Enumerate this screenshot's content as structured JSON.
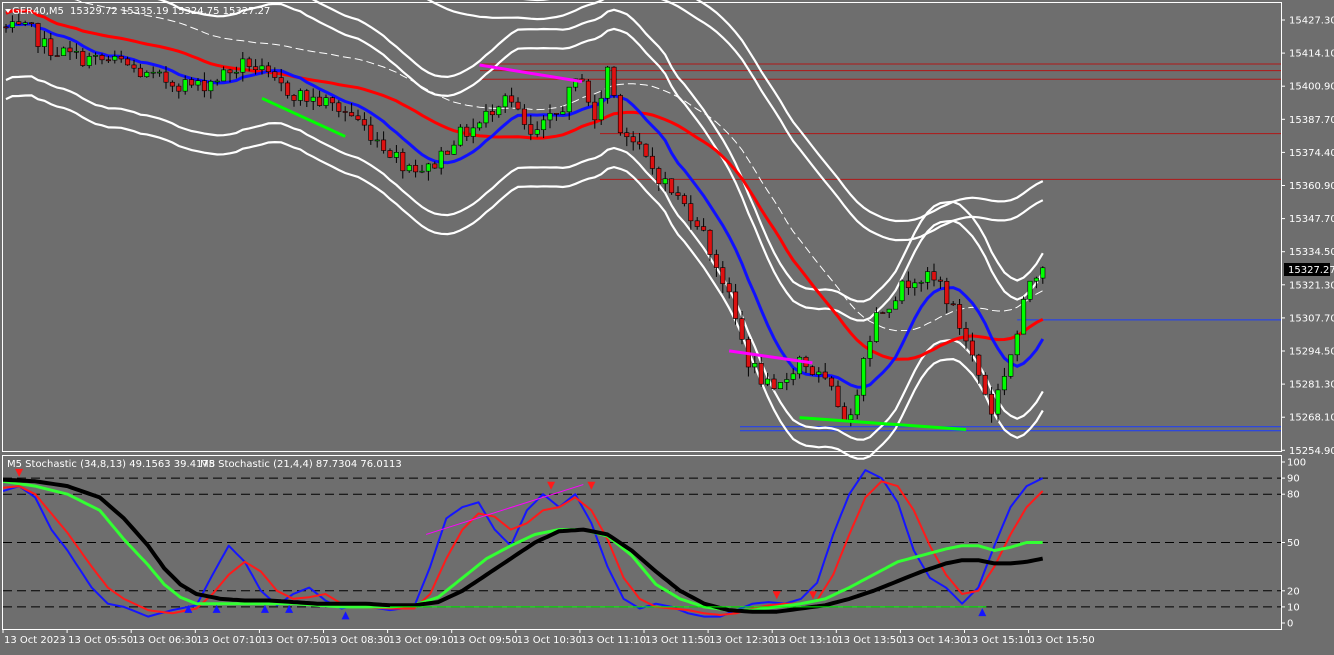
{
  "header": {
    "symbol": "GER40,M5",
    "ohlc": "15329.72 15335.19 15324.75 15327.27"
  },
  "indicator_header": {
    "stoch1": "M5 Stochastic (34,8,13) 49.1563 39.4178",
    "stoch2": "M5 Stochastic (21,4,4) 87.7304 76.0113"
  },
  "current_price_label": "15327.27",
  "colors": {
    "background": "#6e6e6e",
    "bull": "#00ff00",
    "bear": "#dd1111",
    "ma_red": "#ff0000",
    "ma_blue": "#1010ff",
    "envelope": "#ffffff",
    "divergence_magenta": "#ff00ff",
    "divergence_green": "#00ff00",
    "stoch_blue": "#1515ff",
    "stoch_red": "#ff1a1a",
    "stoch_green": "#33ff33",
    "stoch_black": "#000000",
    "level_line": "#b01818",
    "support_line": "#1a3cff"
  },
  "chart_data": [
    {
      "type": "candlestick",
      "panel": "price",
      "ylim": [
        15248.0,
        15436.0
      ],
      "y_ticks": [
        "15427.30",
        "15414.10",
        "15400.90",
        "15387.70",
        "15374.40",
        "15360.90",
        "15347.70",
        "15334.50",
        "15321.30",
        "15307.70",
        "15294.50",
        "15281.30",
        "15268.10",
        "15254.90"
      ],
      "x_ticks": [
        "13 Oct 2023",
        "13 Oct 05:50",
        "13 Oct 06:30",
        "13 Oct 07:10",
        "13 Oct 07:50",
        "13 Oct 08:30",
        "13 Oct 09:10",
        "13 Oct 09:50",
        "13 Oct 10:30",
        "13 Oct 11:10",
        "13 Oct 11:50",
        "13 Oct 12:30",
        "13 Oct 13:10",
        "13 Oct 13:50",
        "13 Oct 14:30",
        "13 Oct 15:10",
        "13 Oct 15:50"
      ],
      "candle_count": 163,
      "close_anchors": [
        [
          0,
          15425
        ],
        [
          4,
          15424
        ],
        [
          6,
          15418
        ],
        [
          10,
          15414
        ],
        [
          14,
          15412
        ],
        [
          18,
          15411
        ],
        [
          22,
          15405
        ],
        [
          26,
          15403
        ],
        [
          30,
          15401
        ],
        [
          34,
          15406
        ],
        [
          38,
          15411
        ],
        [
          42,
          15402
        ],
        [
          46,
          15397
        ],
        [
          50,
          15394
        ],
        [
          54,
          15389
        ],
        [
          58,
          15379
        ],
        [
          62,
          15369
        ],
        [
          66,
          15366
        ],
        [
          70,
          15379
        ],
        [
          74,
          15385
        ],
        [
          78,
          15399
        ],
        [
          82,
          15379
        ],
        [
          86,
          15389
        ],
        [
          90,
          15406
        ],
        [
          92,
          15385
        ],
        [
          94,
          15409
        ],
        [
          96,
          15385
        ],
        [
          100,
          15370
        ],
        [
          104,
          15357
        ],
        [
          108,
          15345
        ],
        [
          112,
          15320
        ],
        [
          116,
          15286
        ],
        [
          120,
          15271
        ],
        [
          124,
          15287
        ],
        [
          128,
          15276
        ],
        [
          132,
          15260
        ],
        [
          134,
          15289
        ],
        [
          136,
          15305
        ],
        [
          138,
          15311
        ],
        [
          142,
          15322
        ],
        [
          146,
          15318
        ],
        [
          150,
          15295
        ],
        [
          154,
          15265
        ],
        [
          158,
          15297
        ],
        [
          160,
          15320
        ],
        [
          162,
          15327.27
        ]
      ],
      "support_level": 15303.0,
      "resistance_levels": [
        15410.4,
        15407.6,
        15404.0,
        15381.2,
        15362.0
      ],
      "bottom_support": [
        15258.2,
        15256.5
      ]
    },
    {
      "type": "line",
      "panel": "stochastic",
      "ylim": [
        0,
        100
      ],
      "y_ticks": [
        "100",
        "90",
        "80",
        "50",
        "20",
        "10",
        "0"
      ],
      "levels": [
        90,
        80,
        50,
        20,
        10
      ],
      "series": [
        {
          "name": "stoch_fast_main",
          "anchors": [
            [
              0,
              82
            ],
            [
              4,
              85
            ],
            [
              8,
              78
            ],
            [
              12,
              58
            ],
            [
              16,
              45
            ],
            [
              22,
              22
            ],
            [
              26,
              12
            ],
            [
              30,
              10
            ],
            [
              36,
              4
            ],
            [
              42,
              8
            ],
            [
              48,
              11
            ],
            [
              52,
              30
            ],
            [
              56,
              48
            ],
            [
              60,
              38
            ],
            [
              64,
              20
            ],
            [
              68,
              11
            ],
            [
              72,
              18
            ],
            [
              76,
              22
            ],
            [
              80,
              14
            ],
            [
              84,
              9
            ],
            [
              88,
              11
            ],
            [
              96,
              8
            ],
            [
              102,
              10
            ],
            [
              106,
              35
            ],
            [
              110,
              65
            ],
            [
              114,
              72
            ],
            [
              118,
              75
            ],
            [
              122,
              58
            ],
            [
              126,
              48
            ],
            [
              130,
              70
            ],
            [
              134,
              80
            ],
            [
              138,
              72
            ],
            [
              142,
              80
            ],
            [
              146,
              62
            ],
            [
              150,
              35
            ],
            [
              154,
              15
            ],
            [
              158,
              9
            ],
            [
              162,
              12
            ],
            [
              166,
              10
            ],
            [
              170,
              6
            ],
            [
              174,
              4
            ],
            [
              178,
              4
            ],
            [
              182,
              8
            ],
            [
              186,
              12
            ],
            [
              190,
              13
            ],
            [
              194,
              12
            ],
            [
              198,
              15
            ],
            [
              202,
              25
            ],
            [
              206,
              55
            ],
            [
              210,
              80
            ],
            [
              214,
              95
            ],
            [
              218,
              90
            ],
            [
              222,
              75
            ],
            [
              226,
              45
            ],
            [
              230,
              28
            ],
            [
              234,
              22
            ],
            [
              238,
              12
            ],
            [
              242,
              22
            ],
            [
              246,
              48
            ],
            [
              250,
              72
            ],
            [
              254,
              85
            ],
            [
              258,
              90
            ]
          ]
        },
        {
          "name": "stoch_fast_signal",
          "anchors": [
            [
              0,
              84
            ],
            [
              4,
              85
            ],
            [
              8,
              80
            ],
            [
              12,
              68
            ],
            [
              16,
              56
            ],
            [
              22,
              35
            ],
            [
              26,
              22
            ],
            [
              30,
              15
            ],
            [
              36,
              8
            ],
            [
              42,
              6
            ],
            [
              48,
              9
            ],
            [
              52,
              18
            ],
            [
              56,
              30
            ],
            [
              60,
              38
            ],
            [
              64,
              32
            ],
            [
              68,
              20
            ],
            [
              72,
              15
            ],
            [
              76,
              16
            ],
            [
              80,
              18
            ],
            [
              84,
              12
            ],
            [
              88,
              10
            ],
            [
              96,
              9
            ],
            [
              102,
              9
            ],
            [
              106,
              18
            ],
            [
              110,
              40
            ],
            [
              114,
              58
            ],
            [
              118,
              68
            ],
            [
              122,
              66
            ],
            [
              126,
              58
            ],
            [
              130,
              62
            ],
            [
              134,
              70
            ],
            [
              138,
              72
            ],
            [
              142,
              78
            ],
            [
              146,
              70
            ],
            [
              150,
              52
            ],
            [
              154,
              28
            ],
            [
              158,
              15
            ],
            [
              162,
              10
            ],
            [
              166,
              9
            ],
            [
              170,
              8
            ],
            [
              174,
              6
            ],
            [
              178,
              5
            ],
            [
              182,
              6
            ],
            [
              186,
              9
            ],
            [
              190,
              11
            ],
            [
              194,
              12
            ],
            [
              198,
              12
            ],
            [
              202,
              14
            ],
            [
              206,
              30
            ],
            [
              210,
              55
            ],
            [
              214,
              78
            ],
            [
              218,
              88
            ],
            [
              222,
              85
            ],
            [
              226,
              70
            ],
            [
              230,
              48
            ],
            [
              234,
              30
            ],
            [
              238,
              18
            ],
            [
              242,
              20
            ],
            [
              246,
              35
            ],
            [
              250,
              55
            ],
            [
              254,
              72
            ],
            [
              258,
              82
            ]
          ]
        },
        {
          "name": "stoch_slow_main",
          "anchors": [
            [
              0,
              88
            ],
            [
              8,
              85
            ],
            [
              16,
              80
            ],
            [
              24,
              70
            ],
            [
              30,
              52
            ],
            [
              36,
              36
            ],
            [
              40,
              24
            ],
            [
              44,
              16
            ],
            [
              48,
              12
            ],
            [
              54,
              12
            ],
            [
              60,
              12
            ],
            [
              66,
              12
            ],
            [
              72,
              12
            ],
            [
              78,
              11
            ],
            [
              84,
              10
            ],
            [
              90,
              10
            ],
            [
              96,
              10
            ],
            [
              102,
              11
            ],
            [
              108,
              16
            ],
            [
              114,
              28
            ],
            [
              120,
              40
            ],
            [
              126,
              48
            ],
            [
              132,
              55
            ],
            [
              138,
              58
            ],
            [
              144,
              58
            ],
            [
              150,
              54
            ],
            [
              156,
              42
            ],
            [
              162,
              24
            ],
            [
              168,
              15
            ],
            [
              174,
              10
            ],
            [
              180,
              8
            ],
            [
              186,
              8
            ],
            [
              192,
              10
            ],
            [
              198,
              12
            ],
            [
              204,
              15
            ],
            [
              210,
              22
            ],
            [
              216,
              30
            ],
            [
              222,
              38
            ],
            [
              228,
              42
            ],
            [
              234,
              46
            ],
            [
              238,
              48
            ],
            [
              242,
              48
            ],
            [
              246,
              45
            ],
            [
              250,
              47
            ],
            [
              254,
              50
            ],
            [
              258,
              50
            ]
          ]
        },
        {
          "name": "stoch_slow_signal",
          "anchors": [
            [
              0,
              89
            ],
            [
              8,
              88
            ],
            [
              16,
              85
            ],
            [
              24,
              78
            ],
            [
              30,
              65
            ],
            [
              36,
              48
            ],
            [
              40,
              34
            ],
            [
              44,
              24
            ],
            [
              48,
              18
            ],
            [
              54,
              15
            ],
            [
              60,
              14
            ],
            [
              66,
              14
            ],
            [
              72,
              13
            ],
            [
              78,
              12
            ],
            [
              84,
              12
            ],
            [
              90,
              12
            ],
            [
              96,
              11
            ],
            [
              102,
              11
            ],
            [
              108,
              13
            ],
            [
              114,
              20
            ],
            [
              120,
              30
            ],
            [
              126,
              40
            ],
            [
              132,
              50
            ],
            [
              138,
              57
            ],
            [
              144,
              58
            ],
            [
              150,
              55
            ],
            [
              156,
              45
            ],
            [
              162,
              32
            ],
            [
              168,
              20
            ],
            [
              174,
              12
            ],
            [
              180,
              8
            ],
            [
              186,
              7
            ],
            [
              192,
              7
            ],
            [
              198,
              9
            ],
            [
              204,
              11
            ],
            [
              210,
              15
            ],
            [
              216,
              20
            ],
            [
              222,
              26
            ],
            [
              228,
              32
            ],
            [
              234,
              37
            ],
            [
              238,
              39
            ],
            [
              242,
              39
            ],
            [
              246,
              37
            ],
            [
              250,
              37
            ],
            [
              254,
              38
            ],
            [
              258,
              40
            ]
          ]
        }
      ],
      "divergence_lines": [
        {
          "from": [
            105,
            55
          ],
          "to": [
            144,
            86
          ]
        },
        {
          "from": [
            96,
            10
          ],
          "to": [
            244,
            10
          ]
        }
      ]
    }
  ]
}
